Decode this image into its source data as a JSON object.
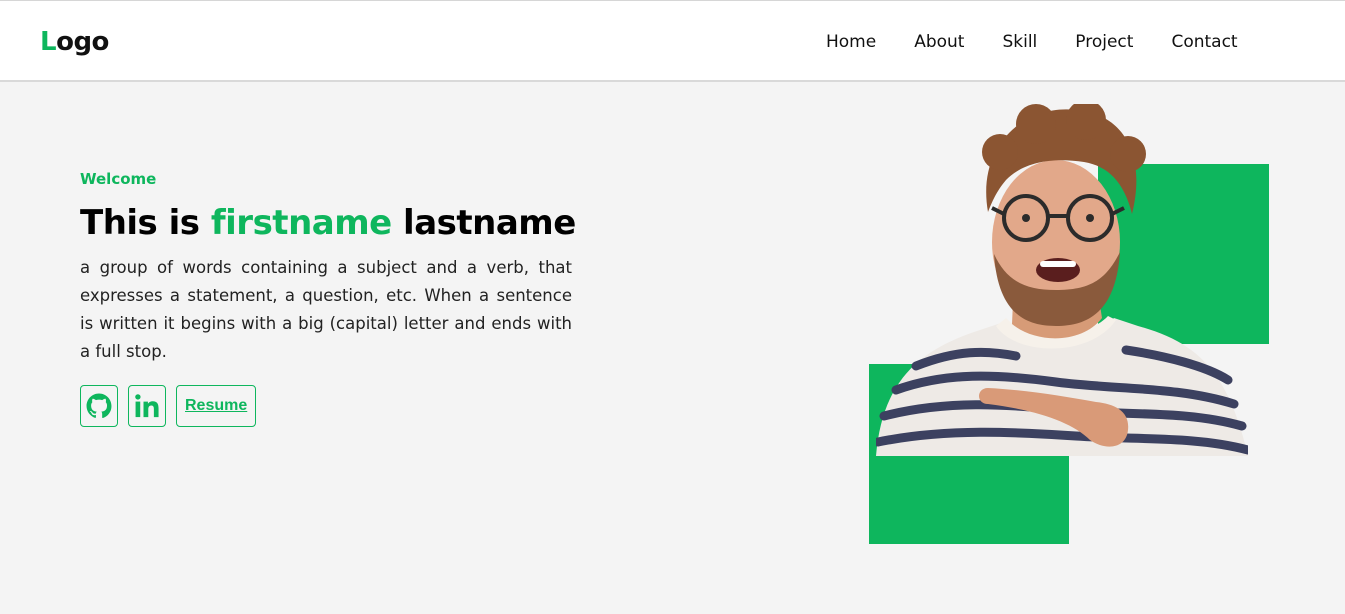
{
  "header": {
    "logo": {
      "first_letter": "L",
      "rest": "ogo"
    },
    "nav": [
      "Home",
      "About",
      "Skill",
      "Project",
      "Contact"
    ]
  },
  "hero": {
    "welcome": "Welcome",
    "headline": {
      "prefix": "This is ",
      "firstname": "firstname",
      "lastname": " lastname"
    },
    "description": "a group of words containing a subject and a verb, that expresses a statement, a question, etc. When a sentence is written it begins with a big (capital) letter and ends with a full stop.",
    "buttons": {
      "github_icon": "github-icon",
      "linkedin_icon": "linkedin-icon",
      "resume": "Resume"
    }
  },
  "colors": {
    "accent": "#0eb65d",
    "background": "#f4f4f4",
    "navbar": "#ffffff",
    "text": "#111111"
  }
}
